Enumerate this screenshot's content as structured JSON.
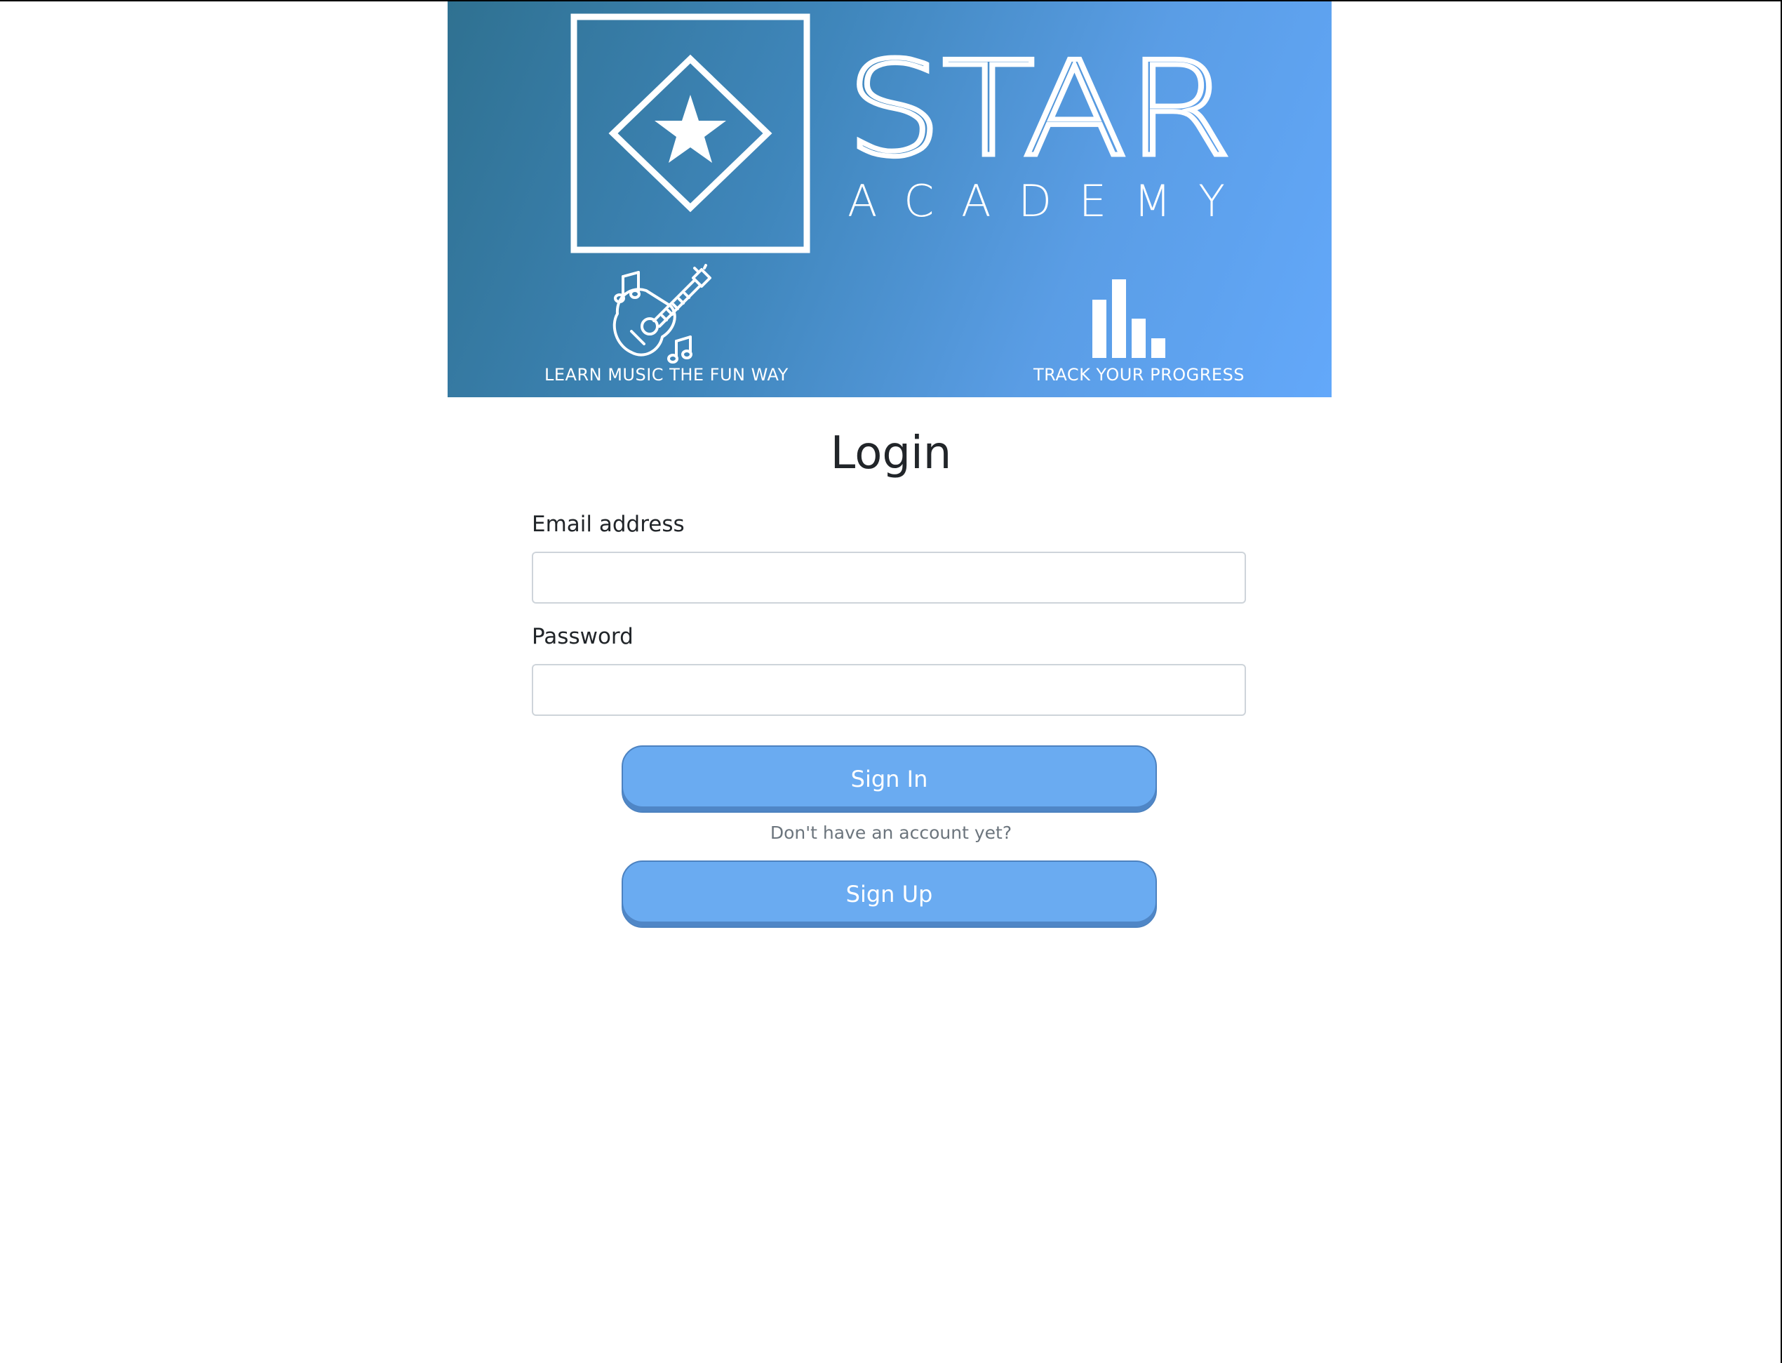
{
  "banner": {
    "logo_title": "STAR",
    "logo_subtitle": "ACADEMY",
    "caption_left": "LEARN MUSIC THE FUN WAY",
    "caption_right": "TRACK YOUR PROGRESS",
    "icons": [
      "star-diamond-logo-icon",
      "guitar-music-notes-icon",
      "bar-chart-icon"
    ],
    "gradient_colors": [
      "#2f7191",
      "#63a8fa"
    ]
  },
  "form": {
    "title": "Login",
    "email_label": "Email address",
    "email_value": "",
    "password_label": "Password",
    "password_value": "",
    "signin_label": "Sign In",
    "helper_text": "Don't have an account yet?",
    "signup_label": "Sign Up"
  },
  "colors": {
    "button_bg": "#6aabf1",
    "button_border": "#4c82c0",
    "text_dark": "#212529",
    "text_muted": "#6c757d"
  }
}
